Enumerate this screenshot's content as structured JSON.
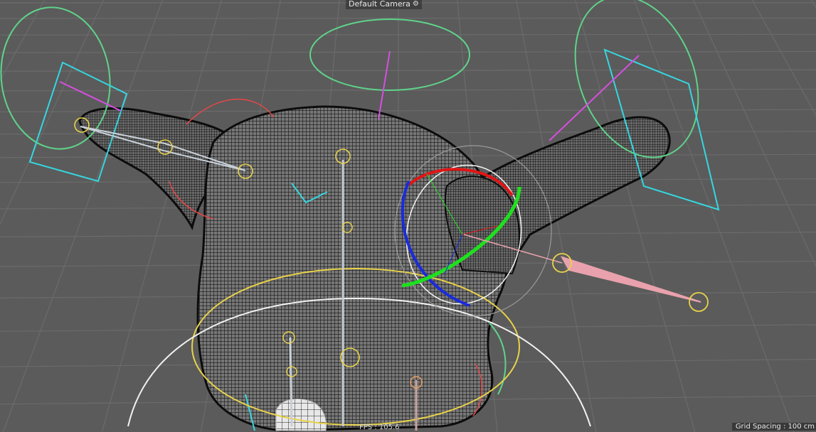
{
  "viewport": {
    "camera_label": "Default Camera",
    "camera_icon": "camera-icon",
    "fps_text": "FPS : 105.6",
    "grid_spacing_text": "Grid Spacing : 100 cm"
  },
  "colors": {
    "background": "#5b5b5b",
    "grid_line": "#6a6a6a",
    "mesh_fill": "#6f6f6f",
    "mesh_wire": "#111111",
    "joint_yellow": "#e8d24a",
    "control_green": "#5fd38a",
    "control_cyan": "#35d7e0",
    "control_magenta": "#d64fe0",
    "control_red": "#e04848",
    "rotate_x_red": "#e01515",
    "rotate_y_green": "#1ee01e",
    "rotate_z_blue": "#1a2bdc",
    "bone_pink": "#e9a2ad",
    "bone_white": "#c8d0d8"
  }
}
